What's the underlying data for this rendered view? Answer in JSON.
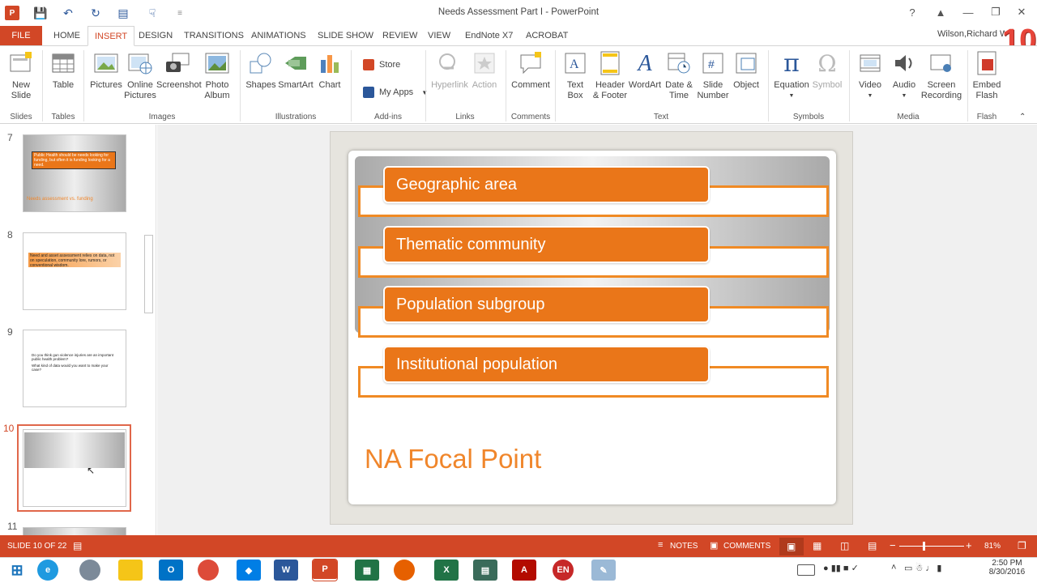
{
  "window": {
    "title": "Needs Assessment Part I - PowerPoint",
    "user": "Wilson,Richard W",
    "badge": "10"
  },
  "tabs": [
    "FILE",
    "HOME",
    "INSERT",
    "DESIGN",
    "TRANSITIONS",
    "ANIMATIONS",
    "SLIDE SHOW",
    "REVIEW",
    "VIEW",
    "EndNote X7",
    "ACROBAT"
  ],
  "ribbon": {
    "buttons": {
      "new_slide": "New\nSlide",
      "table": "Table",
      "pictures": "Pictures",
      "online_pictures": "Online\nPictures",
      "screenshot": "Screenshot",
      "photo_album": "Photo\nAlbum",
      "shapes": "Shapes",
      "smartart": "SmartArt",
      "chart": "Chart",
      "store": "Store",
      "my_apps": "My Apps",
      "hyperlink": "Hyperlink",
      "action": "Action",
      "comment": "Comment",
      "text_box": "Text\nBox",
      "header_footer": "Header\n& Footer",
      "wordart": "WordArt",
      "date_time": "Date &\nTime",
      "slide_number": "Slide\nNumber",
      "object": "Object",
      "equation": "Equation",
      "symbol": "Symbol",
      "video": "Video",
      "audio": "Audio",
      "screen_recording": "Screen\nRecording",
      "embed_flash": "Embed\nFlash"
    },
    "groups": {
      "slides": "Slides",
      "tables": "Tables",
      "images": "Images",
      "illustrations": "Illustrations",
      "addins": "Add-ins",
      "links": "Links",
      "comments": "Comments",
      "text": "Text",
      "symbols": "Symbols",
      "media": "Media",
      "flash": "Flash"
    }
  },
  "thumbnails": {
    "s7": {
      "num": "7",
      "text": "Public Health should be needs looking for funding, but often it is funding looking for a need.",
      "footer": "Needs assessment vs. funding"
    },
    "s8": {
      "num": "8",
      "text": "Need and asset assessment relies on data, not on speculation, community lore, rumors, or conventional wisdom."
    },
    "s9": {
      "num": "9",
      "text": "Do you think gun violence injuries are an important public health problem?",
      "text2": "What kind of data would you want to make your case?"
    },
    "s10": {
      "num": "10"
    },
    "s11": {
      "num": "11"
    }
  },
  "slide": {
    "items": [
      "Geographic area",
      "Thematic community",
      "Population subgroup",
      "Institutional population"
    ],
    "title": "NA Focal Point"
  },
  "status": {
    "slide_of": "SLIDE 10 OF 22",
    "notes": "NOTES",
    "comments": "COMMENTS",
    "zoom": "81%"
  },
  "clock": {
    "time": "2:50 PM",
    "date": "8/30/2016"
  },
  "colors": {
    "accent": "#d24726",
    "orange": "#ea7619"
  }
}
